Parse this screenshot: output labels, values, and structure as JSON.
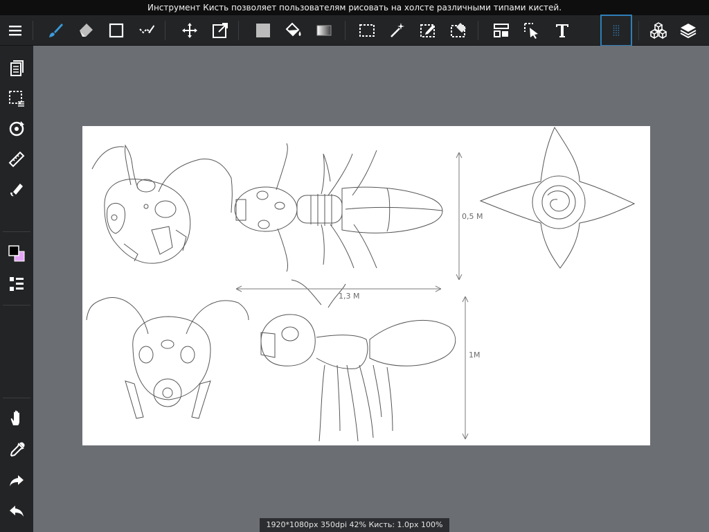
{
  "tip": "Инструмент Кисть позволяет пользователям рисовать на холсте различными типами кистей.",
  "status": "1920*1080px 350dpi 42% Кисть: 1.0px 100%",
  "canvas_labels": {
    "width_top": "1,3 M",
    "height_top": "0,5 M",
    "height_bottom": "1M"
  },
  "colors": {
    "accent": "#2e7fb8",
    "brush_icon": "#3a9ad9",
    "primary_color": "#000000",
    "secondary_color": "#e3a4f5"
  },
  "toolbar_tools": [
    "menu-icon",
    "brush-icon",
    "eraser-icon",
    "rectangle-icon",
    "stroke-correction-icon",
    "move-icon",
    "transform-icon",
    "fill-color-icon",
    "bucket-icon",
    "gradient-icon",
    "selection-icon",
    "magic-wand-icon",
    "select-pen-icon",
    "select-eraser-icon",
    "filter-icon",
    "operation-icon",
    "text-icon",
    "grid-icon",
    "3d-material-icon",
    "layers-icon"
  ],
  "sidebar_tools": [
    "pages-icon",
    "selection-options-icon",
    "rotate-icon",
    "ruler-icon",
    "fill-tool-icon",
    "color-icon",
    "layer-list-icon",
    "hand-icon",
    "eyedropper-icon",
    "redo-icon",
    "undo-icon"
  ]
}
